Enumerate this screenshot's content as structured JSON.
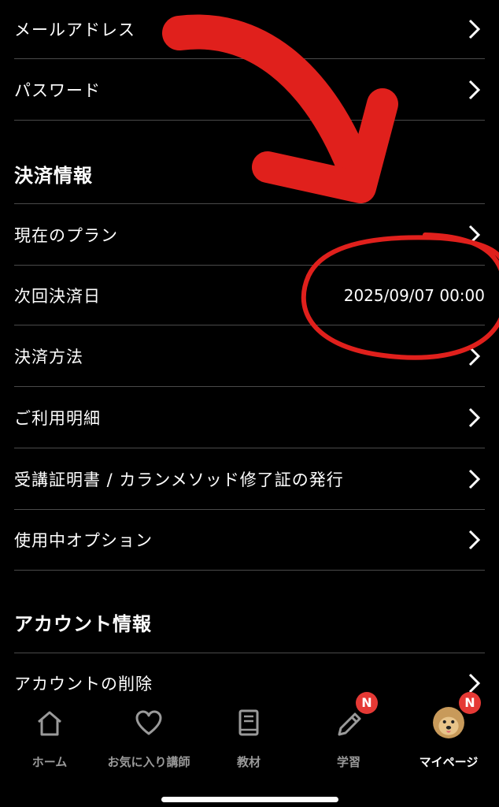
{
  "account_rows": [
    {
      "label": "メールアドレス"
    },
    {
      "label": "パスワード"
    }
  ],
  "payment": {
    "section_title": "決済情報",
    "current_plan": "現在のプラン",
    "next_payment_label": "次回決済日",
    "next_payment_value": "2025/09/07 00:00",
    "method": "決済方法",
    "usage_details": "ご利用明細",
    "certificate": "受講証明書 / カランメソッド修了証の発行",
    "options": "使用中オプション"
  },
  "account_info": {
    "section_title": "アカウント情報",
    "delete": "アカウントの削除"
  },
  "bottom_nav": {
    "home": "ホーム",
    "favorites": "お気に入り講師",
    "materials": "教材",
    "study": "学習",
    "mypage": "マイページ",
    "badge_text": "N"
  },
  "colors": {
    "annotation": "#e0201c",
    "badge": "#e53935",
    "divider": "#4a4a4a"
  },
  "icons": [
    "chevron-right-icon",
    "home-icon",
    "heart-icon",
    "book-icon",
    "pencil-icon",
    "avatar-dog"
  ]
}
